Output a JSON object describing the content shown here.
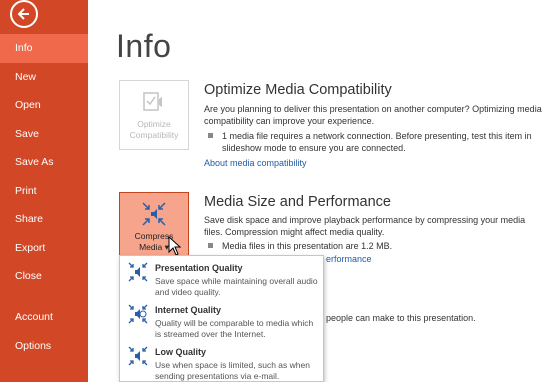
{
  "sidebar": {
    "back_label": "Back",
    "items": [
      {
        "label": "Info",
        "active": true
      },
      {
        "label": "New"
      },
      {
        "label": "Open"
      },
      {
        "label": "Save"
      },
      {
        "label": "Save As"
      },
      {
        "label": "Print"
      },
      {
        "label": "Share"
      },
      {
        "label": "Export"
      },
      {
        "label": "Close"
      }
    ],
    "bottom_items": [
      {
        "label": "Account"
      },
      {
        "label": "Options"
      }
    ]
  },
  "page_title": "Info",
  "optimize": {
    "tile_label_line1": "Optimize",
    "tile_label_line2": "Compatibility",
    "title": "Optimize Media Compatibility",
    "description": "Are you planning to deliver this presentation on another computer? Optimizing media compatibility can improve your experience.",
    "bullet": "1 media file requires a network connection. Before presenting, test this item in slideshow mode to ensure you are connected.",
    "link": "About media compatibility"
  },
  "compress": {
    "tile_label_line1": "Compress",
    "tile_label_line2": "Media",
    "title": "Media Size and Performance",
    "description": "Save disk space and improve playback performance by compressing your media files. Compression might affect media quality.",
    "bullet": "Media files in this presentation are 1.2 MB.",
    "link_partial": "erformance",
    "partial_text": "people can make to this presentation."
  },
  "menu": {
    "items": [
      {
        "title": "Presentation Quality",
        "desc": "Save space while maintaining overall audio and video quality."
      },
      {
        "title": "Internet Quality",
        "desc": "Quality will be comparable to media which is streamed over the Internet."
      },
      {
        "title": "Low Quality",
        "desc": "Use when space is limited, such as when sending presentations via e-mail."
      }
    ]
  },
  "colors": {
    "sidebar": "#d24726",
    "sidebar_active": "#f0694a",
    "tile_highlight": "#f6a58c",
    "link": "#1f5da8"
  }
}
